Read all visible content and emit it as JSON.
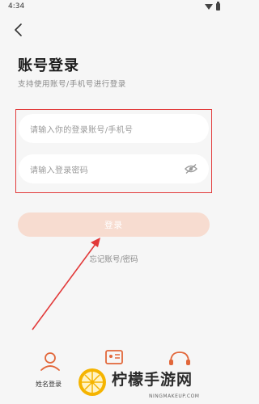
{
  "status": {
    "time": "4:34"
  },
  "header": {
    "title": "账号登录",
    "subtitle": "支持使用账号/手机号进行登录"
  },
  "form": {
    "account_placeholder": "请输入你的登录账号/手机号",
    "password_placeholder": "请输入登录密码",
    "login_label": "登录",
    "forgot_label": "忘记账号/密码"
  },
  "bottom": {
    "name_login_label": "姓名登录"
  },
  "watermark": {
    "brand": "柠檬手游网",
    "domain": "NINGMAKEUP.COM"
  },
  "colors": {
    "accent": "#e23a3a",
    "button": "#f7dcd0",
    "icon_orange": "#e2673a"
  }
}
